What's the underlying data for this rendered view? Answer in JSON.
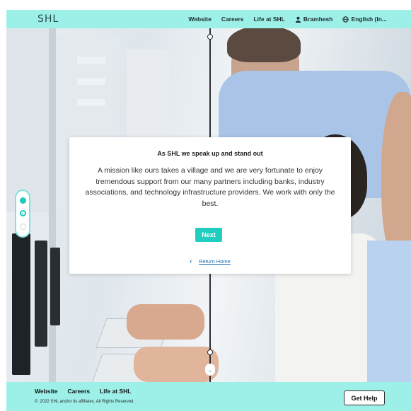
{
  "header": {
    "logo": "SHL",
    "nav": {
      "website": "Website",
      "careers": "Careers",
      "life": "Life at SHL",
      "user": "Bramhesh",
      "language": "English (In..."
    }
  },
  "card": {
    "heading": "As SHL we speak up and stand out",
    "body": "A mission like ours takes a village and we are very fortunate to enjoy tremendous support from our many partners including banks, industry associations, and technology infrastructure providers. We work with only the best.",
    "next_label": "Next",
    "return_label": "Return Home"
  },
  "stepper": {
    "steps": [
      "completed",
      "current",
      "upcoming"
    ]
  },
  "footer": {
    "links": {
      "website": "Website",
      "careers": "Careers",
      "life": "Life at SHL"
    },
    "copyright": "2022 SHL and/or its affiliates. All Rights Reserved.",
    "help_label": "Get Help"
  },
  "colors": {
    "accent": "#21cdbf",
    "header_bg": "#9cf0e8",
    "link": "#1a6fb5"
  },
  "icons": [
    "user-icon",
    "globe-icon",
    "chevron-left-icon",
    "chevron-down-icon",
    "copyright-icon"
  ]
}
